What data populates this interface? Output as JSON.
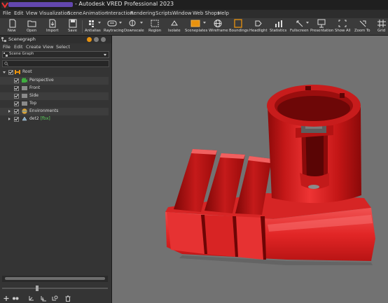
{
  "window": {
    "title": "- Autodesk VRED Professional 2023"
  },
  "menu": [
    "File",
    "Edit",
    "View",
    "Visualization",
    "Scene",
    "Animation",
    "Interaction",
    "Rendering",
    "Scripts",
    "Window",
    "Web Shops",
    "Help"
  ],
  "toolbar": [
    {
      "label": "New",
      "icon": "new-file-icon"
    },
    {
      "label": "Open",
      "icon": "open-folder-icon"
    },
    {
      "label": "Import",
      "icon": "import-icon"
    },
    {
      "label": "Save",
      "icon": "save-icon"
    },
    {
      "label": "Antialias",
      "icon": "antialias-icon"
    },
    {
      "label": "Raytracing",
      "icon": "raytracing-icon"
    },
    {
      "label": "Downscale",
      "icon": "downscale-icon"
    },
    {
      "label": "Region",
      "icon": "region-icon"
    },
    {
      "label": "Isolate",
      "icon": "isolate-icon"
    },
    {
      "label": "Sceneplates",
      "icon": "sceneplates-icon"
    },
    {
      "label": "Wireframe",
      "icon": "wireframe-icon"
    },
    {
      "label": "Boundings",
      "icon": "boundings-icon"
    },
    {
      "label": "Headlight",
      "icon": "headlight-icon"
    },
    {
      "label": "Statistics",
      "icon": "statistics-icon"
    },
    {
      "label": "Fullscreen",
      "icon": "fullscreen-icon"
    },
    {
      "label": "Presentation",
      "icon": "presentation-icon"
    },
    {
      "label": "Show All",
      "icon": "show-all-icon"
    },
    {
      "label": "Zoom To",
      "icon": "zoom-to-icon"
    },
    {
      "label": "Grid",
      "icon": "grid-icon"
    }
  ],
  "scenegraph": {
    "title": "Scenegraph",
    "menu": [
      "File",
      "Edit",
      "Create",
      "View",
      "Select"
    ],
    "combo_value": "Scene Graph",
    "search_placeholder": "",
    "tree": [
      {
        "name": "Root",
        "tag": "",
        "icon": "root-node-icon",
        "level": 0
      },
      {
        "name": "Perspective",
        "tag": "",
        "icon": "camera-icon",
        "level": 1
      },
      {
        "name": "Front",
        "tag": "",
        "icon": "view-icon",
        "level": 1
      },
      {
        "name": "Side",
        "tag": "",
        "icon": "view-icon",
        "level": 1
      },
      {
        "name": "Top",
        "tag": "",
        "icon": "view-icon",
        "level": 1
      },
      {
        "name": "Environments",
        "tag": "",
        "icon": "environment-icon",
        "level": 1
      },
      {
        "name": "det2",
        "tag": "[fbx]",
        "icon": "geometry-icon",
        "level": 1
      }
    ],
    "bottom_buttons": [
      "add-node-icon",
      "group-icon",
      "transform-icon",
      "clone-icon",
      "link-icon",
      "delete-icon"
    ]
  },
  "viewport": {
    "object": "red 3D part det2",
    "colors": {
      "background": "#727272",
      "object": "#d81c1c"
    }
  }
}
